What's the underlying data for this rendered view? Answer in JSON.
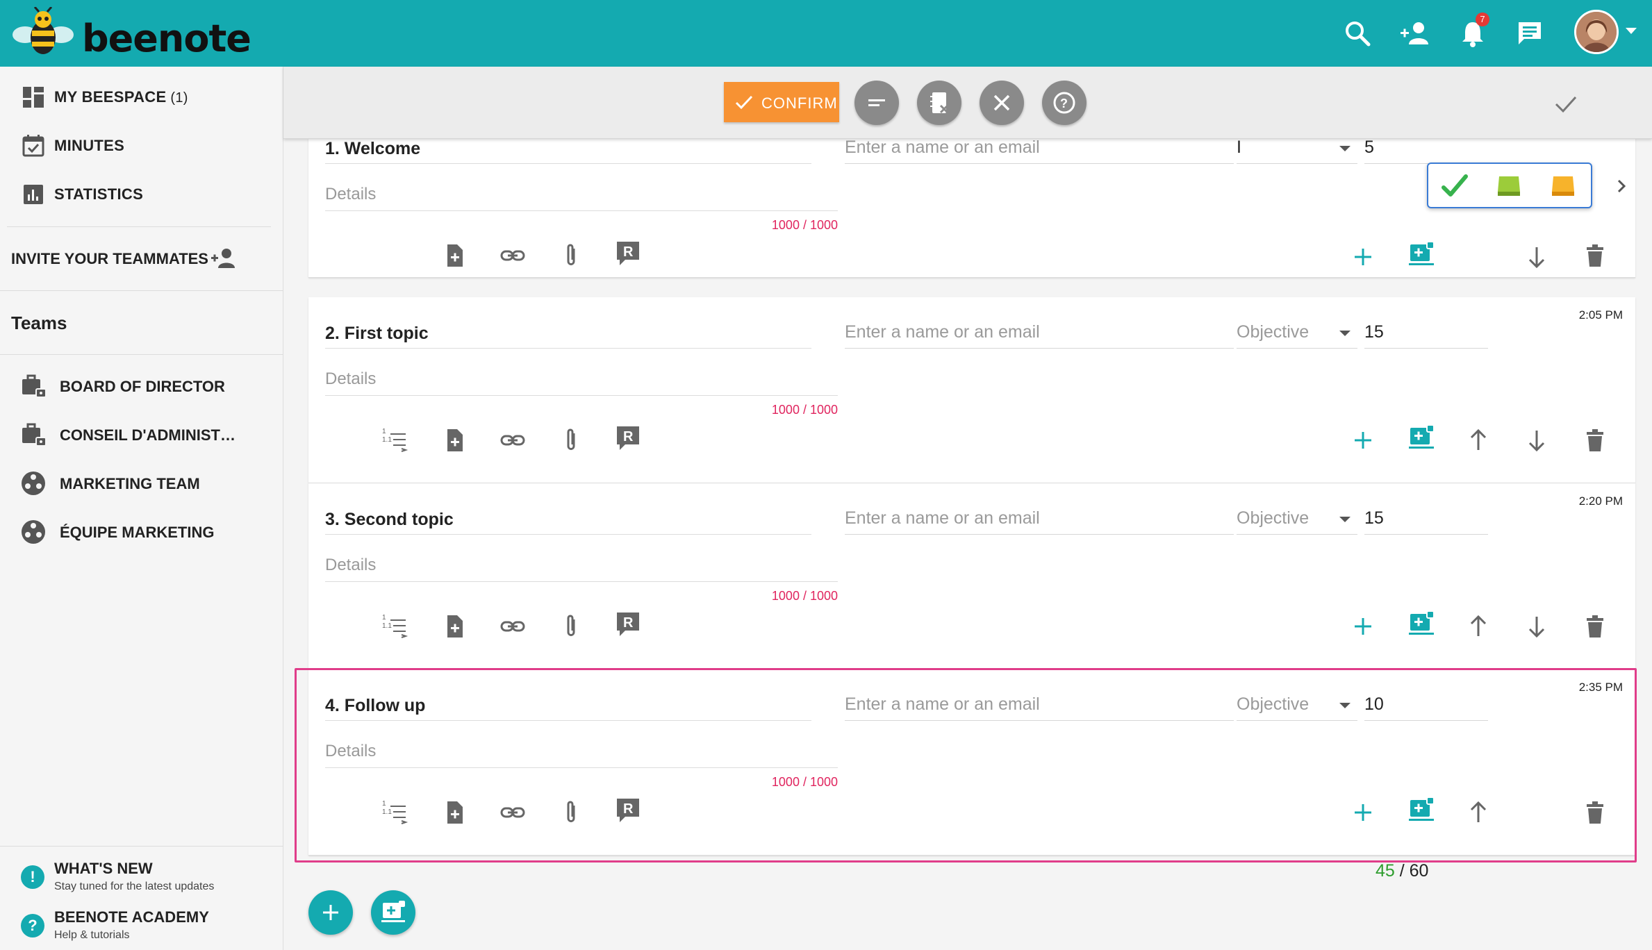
{
  "app": {
    "brand": "beenote",
    "notification_count": "7",
    "colors": {
      "primary": "#14aab0",
      "confirm": "#f79233",
      "counter_red": "#e0245e",
      "highlight": "#e03d8a",
      "used_green": "#2e9d2e"
    }
  },
  "sidebar": {
    "nav": [
      {
        "label": "MY BEESPACE",
        "count": "(1)",
        "icon": "dashboard-icon"
      },
      {
        "label": "MINUTES",
        "count": "",
        "icon": "calendar-check-icon"
      },
      {
        "label": "STATISTICS",
        "count": "",
        "icon": "bar-chart-icon"
      }
    ],
    "invite_label": "INVITE YOUR TEAMMATES",
    "teams_title": "Teams",
    "teams": [
      {
        "label": "BOARD OF DIRECTOR",
        "icon": "briefcase-lock-icon"
      },
      {
        "label": "CONSEIL D'ADMINISTRATION",
        "icon": "briefcase-lock-icon"
      },
      {
        "label": "MARKETING TEAM",
        "icon": "team-icon"
      },
      {
        "label": "ÉQUIPE MARKETING",
        "icon": "team-icon"
      }
    ],
    "footer": [
      {
        "title": "WHAT'S NEW",
        "subtitle": "Stay tuned for the latest updates",
        "icon": "!"
      },
      {
        "title": "BEENOTE ACADEMY",
        "subtitle": "Help & tutorials",
        "icon": "?"
      }
    ]
  },
  "toolbar": {
    "confirm_label": "CONFIRM"
  },
  "agenda": {
    "details_placeholder": "Details",
    "person_placeholder": "Enter a name or an email",
    "counter": "1000 / 1000",
    "items": [
      {
        "title": "1. Welcome",
        "type": "I",
        "duration": "5",
        "time": ""
      },
      {
        "title": "2. First topic",
        "type": "Objective",
        "duration": "15",
        "time": "2:05 PM"
      },
      {
        "title": "3. Second topic",
        "type": "Objective",
        "duration": "15",
        "time": "2:20 PM"
      },
      {
        "title": "4. Follow up",
        "type": "Objective",
        "duration": "10",
        "time": "2:35 PM"
      }
    ],
    "totals": {
      "used": "45",
      "total": "/ 60"
    }
  }
}
